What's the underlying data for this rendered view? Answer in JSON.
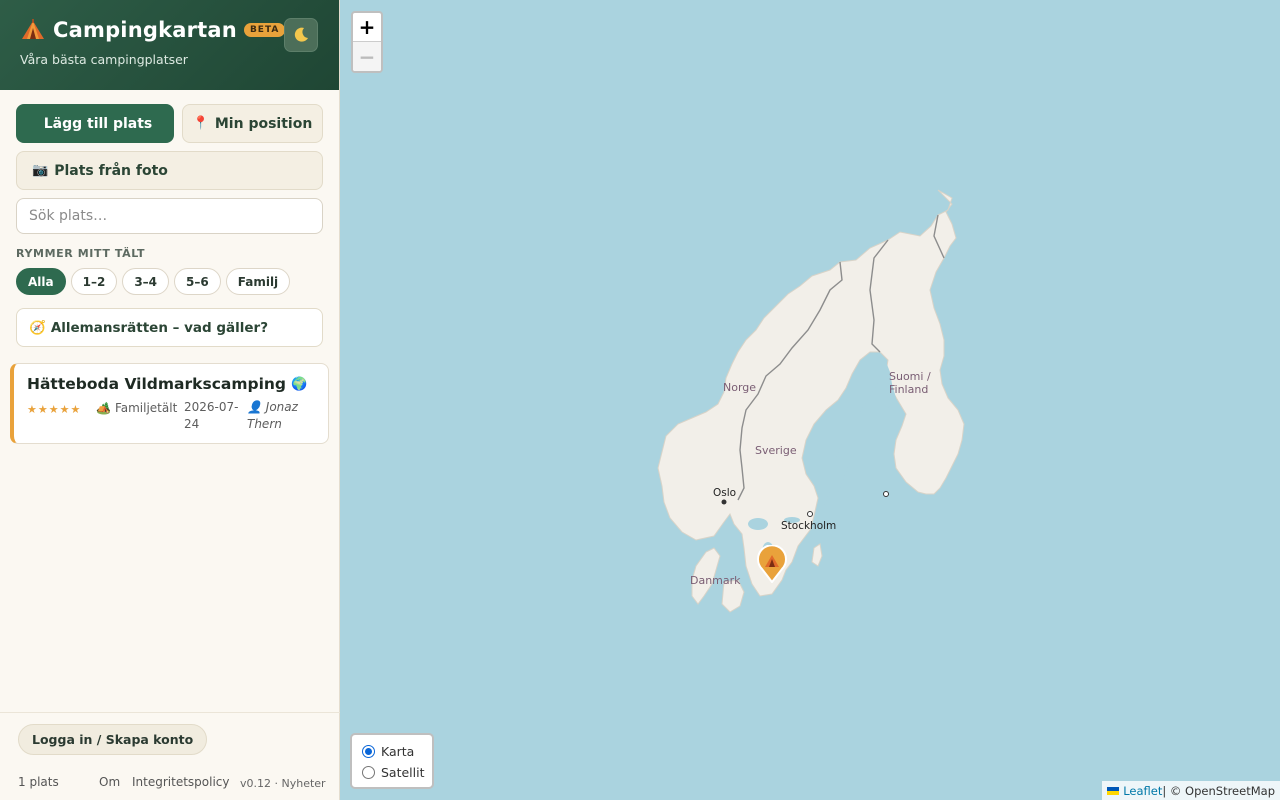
{
  "app": {
    "title": "Campingkartan",
    "badge": "BETA",
    "subtitle": "Våra bästa campingplatser",
    "theme_icon": "moon-icon"
  },
  "actions": {
    "add_place": "Lägg till plats",
    "add_place_icon": "",
    "my_position": "Min position",
    "my_position_icon": "📍",
    "photo_place": "Plats från foto",
    "photo_place_icon": "📷"
  },
  "search": {
    "placeholder": "Sök plats…",
    "value": ""
  },
  "filter": {
    "label": "RYMMER MITT TÄLT",
    "options": [
      "Alla",
      "1–2",
      "3–4",
      "5–6",
      "Familj"
    ],
    "selected": "Alla"
  },
  "info": {
    "label": "Allemansrätten – vad gäller?",
    "icon": "🧭"
  },
  "places": [
    {
      "name": "Hätteboda Vildmarkscamping",
      "name_icon": "🌍",
      "rating": "★★★★★",
      "tent_icon": "🏕️",
      "tent_type": "Familjetält",
      "date": "2026-07-24",
      "author_icon": "👤",
      "author": "Jonaz Thern"
    }
  ],
  "footer": {
    "login": "Logga in / Skapa konto",
    "count": "1 plats",
    "about": "Om",
    "privacy": "Integritetspolicy",
    "version": "v0.12 · Nyheter"
  },
  "map": {
    "zoom_in": "+",
    "zoom_out": "−",
    "layers": {
      "map": "Karta",
      "satellite": "Satellit",
      "selected": "Karta"
    },
    "labels": {
      "norway": "Norge",
      "sweden": "Sverige",
      "finland_1": "Suomi /",
      "finland_2": "Finland",
      "oslo": "Oslo",
      "stockholm": "Stockholm",
      "denmark": "Danmark"
    },
    "attribution_leaflet": "Leaflet",
    "attribution_osm": " | © OpenStreetMap",
    "colors": {
      "water": "#aad3df",
      "land": "#f2efe9",
      "border": "#8d8d8d",
      "marker": "#e9a23b"
    }
  }
}
